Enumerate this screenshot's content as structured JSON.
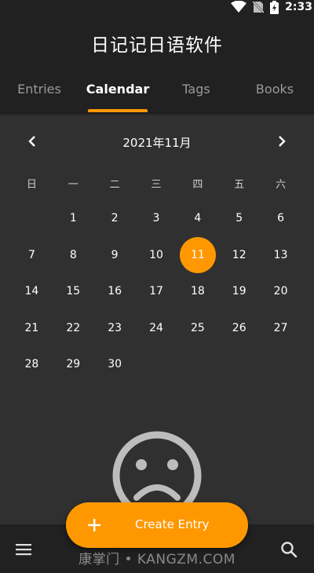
{
  "status": {
    "time": "2:33"
  },
  "app": {
    "title": "日记记日语软件"
  },
  "tabs": [
    {
      "label": "Entries",
      "active": false
    },
    {
      "label": "Calendar",
      "active": true
    },
    {
      "label": "Tags",
      "active": false
    },
    {
      "label": "Books",
      "active": false
    }
  ],
  "calendar": {
    "month_label": "2021年11月",
    "weekdays": [
      "日",
      "一",
      "二",
      "三",
      "四",
      "五",
      "六"
    ],
    "weeks": [
      [
        "",
        "1",
        "2",
        "3",
        "4",
        "5",
        "6"
      ],
      [
        "7",
        "8",
        "9",
        "10",
        "11",
        "12",
        "13"
      ],
      [
        "14",
        "15",
        "16",
        "17",
        "18",
        "19",
        "20"
      ],
      [
        "21",
        "22",
        "23",
        "24",
        "25",
        "26",
        "27"
      ],
      [
        "28",
        "29",
        "30",
        "",
        "",
        "",
        ""
      ]
    ],
    "selected_day": "11"
  },
  "empty_state": {
    "icon": "sad-face-icon"
  },
  "fab": {
    "label": "Create Entry"
  },
  "bottom_bar": {
    "watermark": "康掌门 • KANGZM.COM"
  },
  "colors": {
    "accent": "#FF9800",
    "header_bg": "#212121",
    "body_bg": "#303030"
  }
}
